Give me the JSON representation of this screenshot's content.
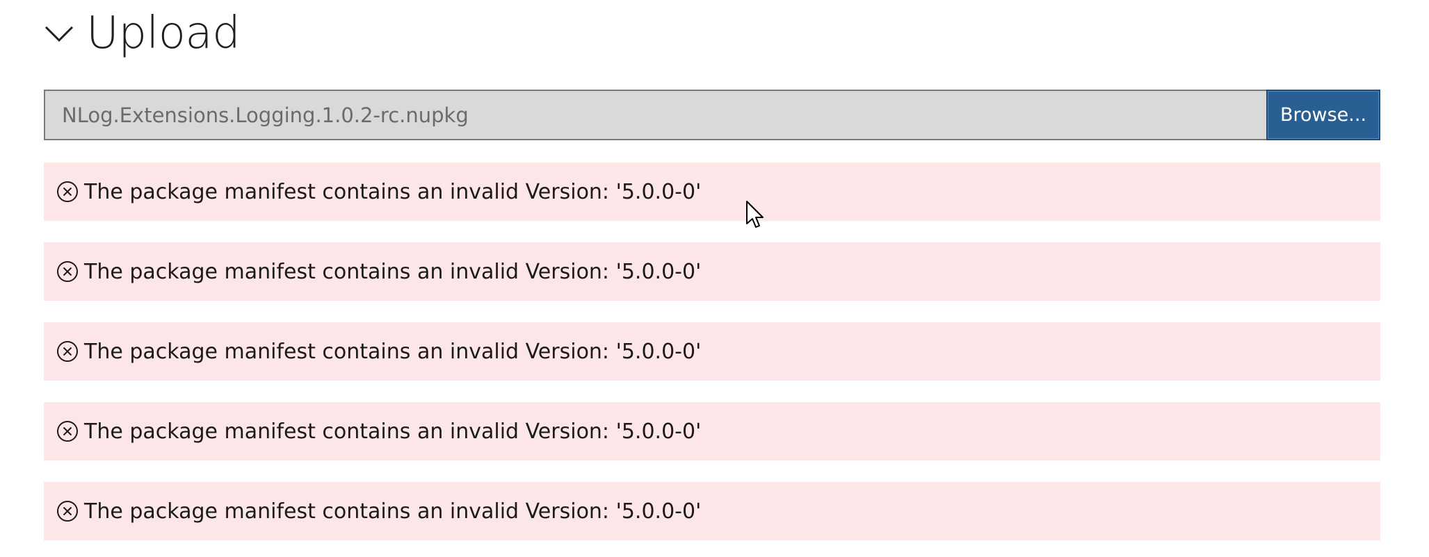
{
  "section": {
    "title": "Upload",
    "expander_icon": "chevron-down-icon"
  },
  "upload": {
    "file_value": "NLog.Extensions.Logging.1.0.2-rc.nupkg",
    "browse_label": "Browse..."
  },
  "errors": [
    {
      "icon": "error-circle-icon",
      "message": "The package manifest contains an invalid Version: '5.0.0-0'"
    },
    {
      "icon": "error-circle-icon",
      "message": "The package manifest contains an invalid Version: '5.0.0-0'"
    },
    {
      "icon": "error-circle-icon",
      "message": "The package manifest contains an invalid Version: '5.0.0-0'"
    },
    {
      "icon": "error-circle-icon",
      "message": "The package manifest contains an invalid Version: '5.0.0-0'"
    },
    {
      "icon": "error-circle-icon",
      "message": "The package manifest contains an invalid Version: '5.0.0-0'"
    }
  ],
  "colors": {
    "error_background": "#fde6e8",
    "browse_button": "#2a5f93",
    "input_background": "#d9d9d9"
  }
}
